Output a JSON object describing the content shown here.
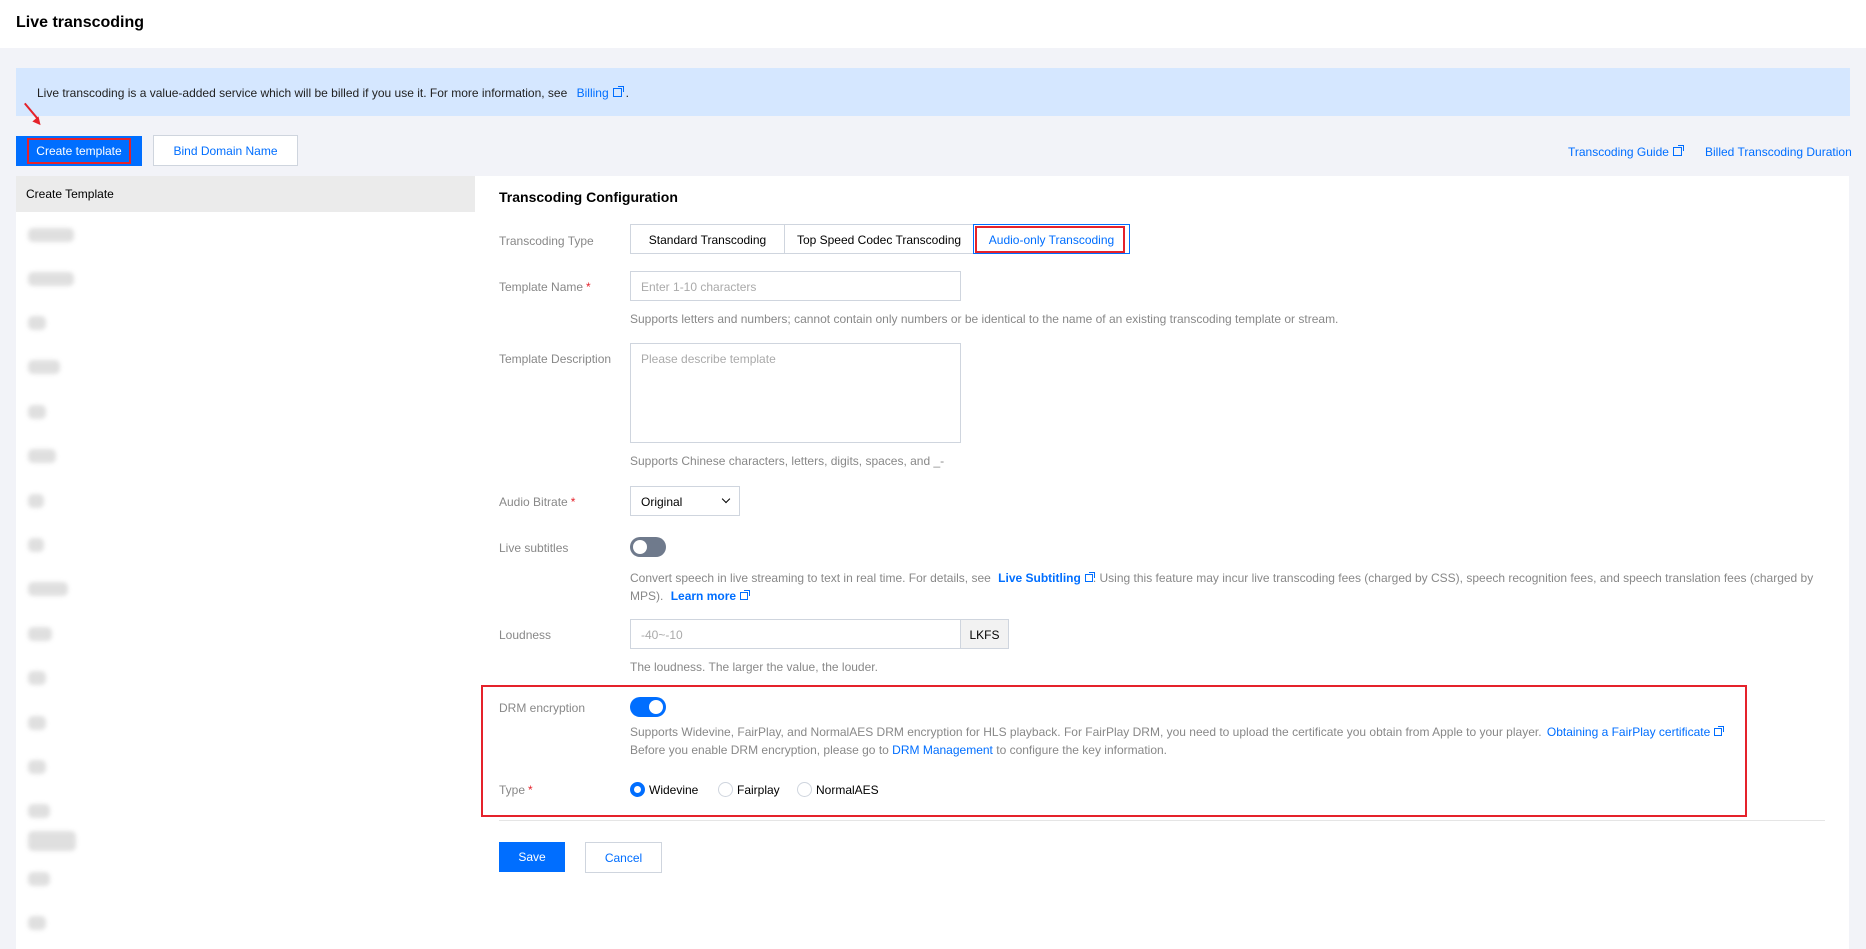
{
  "page": {
    "title": "Live transcoding"
  },
  "notice": {
    "text": "Live transcoding is a value-added service which will be billed if you use it. For more information, see",
    "link": "Billing",
    "suffix": "."
  },
  "toolbar": {
    "create_template": "Create template",
    "bind_domain": "Bind Domain Name",
    "transcoding_guide": "Transcoding Guide",
    "billed_duration": "Billed Transcoding Duration"
  },
  "left_panel": {
    "header": "Create Template"
  },
  "config": {
    "title": "Transcoding Configuration",
    "transcoding_type": {
      "label": "Transcoding Type",
      "options": [
        "Standard Transcoding",
        "Top Speed Codec Transcoding",
        "Audio-only Transcoding"
      ],
      "selected": "Audio-only Transcoding"
    },
    "template_name": {
      "label": "Template Name",
      "required_mark": "*",
      "placeholder": "Enter 1-10 characters",
      "hint": "Supports letters and numbers; cannot contain only numbers or be identical to the name of an existing transcoding template or stream."
    },
    "template_description": {
      "label": "Template Description",
      "placeholder": "Please describe template",
      "hint": "Supports Chinese characters, letters, digits, spaces, and _-"
    },
    "audio_bitrate": {
      "label": "Audio Bitrate",
      "required_mark": "*",
      "value": "Original"
    },
    "live_subtitles": {
      "label": "Live subtitles",
      "enabled": false,
      "hint_prefix": "Convert speech in live streaming to text in real time. For details, see",
      "hint_link": "Live Subtitling",
      "hint_middle": ". Using this feature may incur live transcoding fees (charged by CSS), speech recognition fees, and speech translation fees (charged by",
      "hint_line2": "MPS).",
      "learn_more": "Learn more"
    },
    "loudness": {
      "label": "Loudness",
      "placeholder": "-40~-10",
      "unit": "LKFS",
      "hint": "The loudness. The larger the value, the louder."
    },
    "drm": {
      "label": "DRM encryption",
      "enabled": true,
      "hint_line1": "Supports Widevine, FairPlay, and NormalAES DRM encryption for HLS playback. For FairPlay DRM, you need to upload the certificate you obtain from Apple to your player.",
      "hint_line1_link": "Obtaining a FairPlay certificate",
      "hint_line2_prefix": "Before you enable DRM encryption, please go to",
      "hint_line2_link": "DRM Management",
      "hint_line2_suffix": "to configure the key information.",
      "type_label": "Type",
      "type_required_mark": "*",
      "type_options": [
        "Widevine",
        "Fairplay",
        "NormalAES"
      ],
      "type_selected": "Widevine"
    },
    "actions": {
      "save": "Save",
      "cancel": "Cancel"
    }
  },
  "colors": {
    "accent": "#006eff",
    "highlight": "#e5222b",
    "notice_bg": "#d5e7ff"
  }
}
